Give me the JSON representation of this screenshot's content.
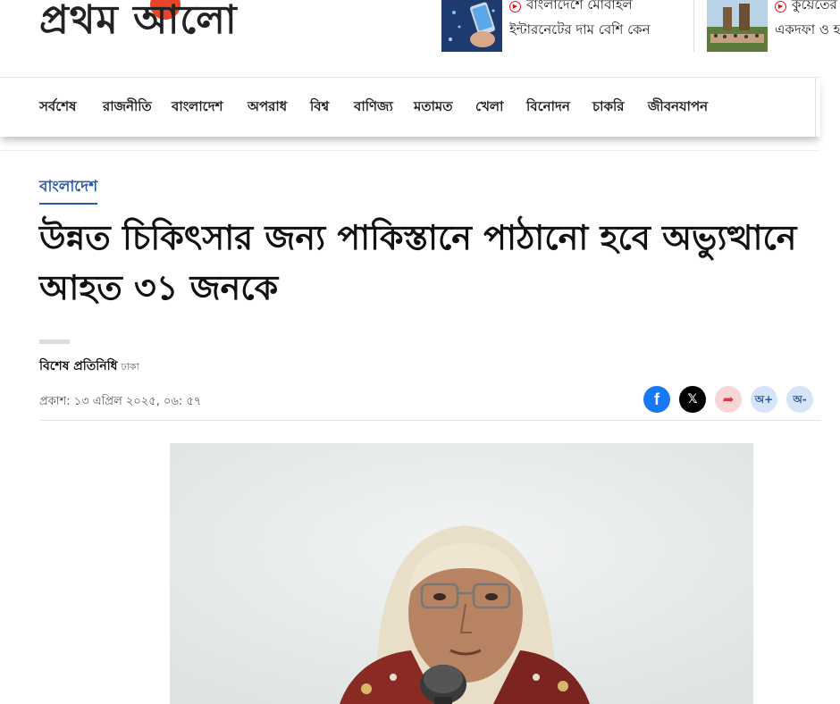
{
  "header": {
    "logo_text": "প্রথম আলো",
    "teasers": [
      {
        "line1": "বাংলাদেশে মোবাইল",
        "line2": "ইন্টারনেটের দাম বেশি কেন"
      },
      {
        "line1": "কুয়েতের",
        "line2": "একদফা ও হ"
      }
    ]
  },
  "nav": {
    "items": [
      "সর্বশেষ",
      "রাজনীতি",
      "বাংলাদেশ",
      "অপরাধ",
      "বিশ্ব",
      "বাণিজ্য",
      "মতামত",
      "খেলা",
      "বিনোদন",
      "চাকরি",
      "জীবনযাপন"
    ]
  },
  "article": {
    "section": "বাংলাদেশ",
    "headline": "উন্নত চিকিৎসার জন্য পাকিস্তানে পাঠানো হবে অভ্যুত্থানে আহত ৩১ জনকে",
    "author": "বিশেষ প্রতিনিধি",
    "location": "ঢাকা",
    "published": "প্রকাশ: ১৩ এপ্রিল ২০২৫, ০৬: ৫৭"
  },
  "share": {
    "facebook": "f",
    "x": "𝕏",
    "share": "➦",
    "font_increase": "অ+",
    "font_decrease": "অ-"
  },
  "colors": {
    "section_blue": "#2a5aa8",
    "facebook_blue": "#1877f2",
    "share_pink": "#f8d5d8",
    "font_button_blue": "#d6e4f7",
    "logo_sun": "#e8442a"
  }
}
